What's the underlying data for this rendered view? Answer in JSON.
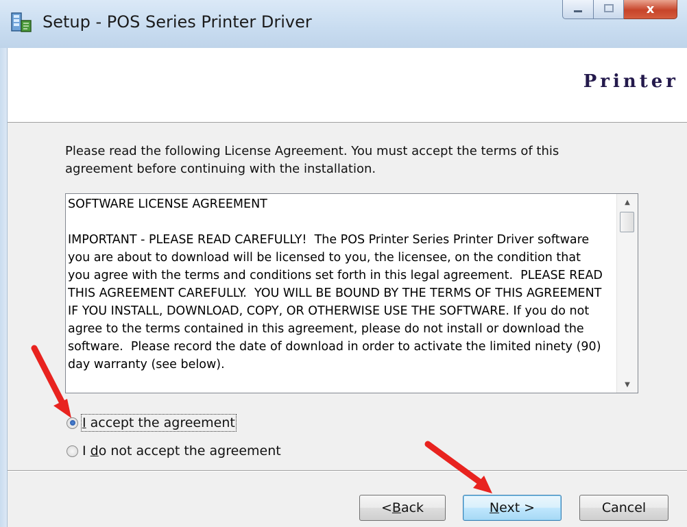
{
  "window": {
    "title": "Setup - POS Series Printer Driver",
    "close_glyph": "x"
  },
  "header": {
    "brand": "Printer"
  },
  "instructions": "Please read the following License Agreement. You must accept the terms of this agreement before continuing with the installation.",
  "license": {
    "heading": "SOFTWARE LICENSE AGREEMENT",
    "body": "IMPORTANT - PLEASE READ CAREFULLY!  The POS Printer Series Printer Driver software you are about to download will be licensed to you, the licensee, on the condition that you agree with the terms and conditions set forth in this legal agreement.  PLEASE READ THIS AGREEMENT CAREFULLY.  YOU WILL BE BOUND BY THE TERMS OF THIS AGREEMENT IF YOU INSTALL, DOWNLOAD, COPY, OR OTHERWISE USE THE SOFTWARE. If you do not agree to the terms contained in this agreement, please do not install or download the software.  Please record the date of download in order to activate the limited ninety (90) day warranty (see below)."
  },
  "options": {
    "accept": {
      "access_key": "I",
      "rest": " accept the agreement",
      "selected": true
    },
    "decline": {
      "prefix": "I ",
      "access_key": "d",
      "rest": "o not accept the agreement",
      "selected": false
    }
  },
  "buttons": {
    "back": {
      "prefix": "< ",
      "access_key": "B",
      "rest": "ack"
    },
    "next": {
      "access_key": "N",
      "rest": "ext >"
    },
    "cancel": "Cancel"
  },
  "colors": {
    "annotation_arrow": "#e8231f",
    "brand_text": "#241a4c"
  }
}
